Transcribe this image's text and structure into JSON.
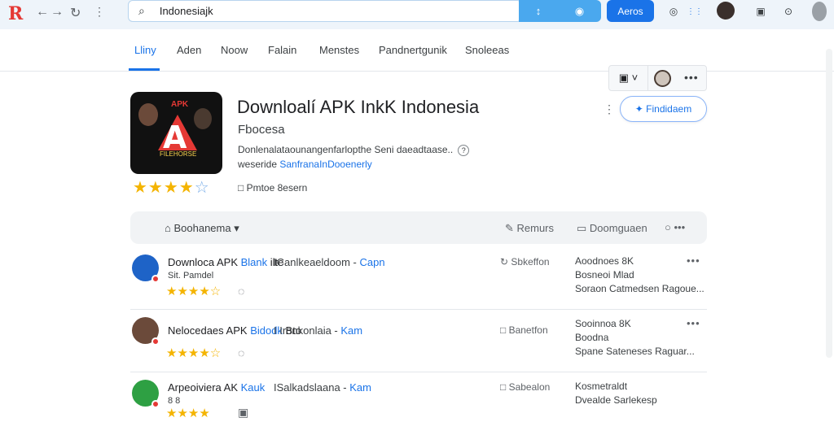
{
  "browser": {
    "logo": "R",
    "back": "←",
    "forward": "→",
    "reload": "↻",
    "more_vert": "⋮",
    "search_glyph": "⌕",
    "url_value": "Indonesiajk",
    "url_icons": [
      "↕",
      "◉"
    ],
    "go_label": "Aeros",
    "right_icons": [
      "◎",
      "⋮⋮",
      "▣",
      "⊙"
    ]
  },
  "tabs": [
    {
      "label": "Lliny",
      "active": true
    },
    {
      "label": "Aden"
    },
    {
      "label": "Noow"
    },
    {
      "label": "Falain"
    },
    {
      "label": "Menstes"
    },
    {
      "label": "Pandnertgunik"
    },
    {
      "label": "Snoleeas"
    }
  ],
  "toolbar": {
    "filter_glyph": "▣ ˅",
    "more": "•••"
  },
  "app": {
    "icon_letter": "A",
    "icon_corner": "APK",
    "icon_tagline": "FILEHORSE",
    "stars": "★★★★",
    "stars_off": "☆",
    "title": "Downloalí APK InkK Indonesia",
    "subtitle": "Fbocesa",
    "description": "Donlenalataounangenfarlopthe Seni daeadtaase..",
    "description_q": "?",
    "website_prefix": "weseride",
    "website_link": "SanfranaInDooenerly",
    "meta_icon": "□",
    "meta": "Pmtoe 8esern",
    "kebab": "⋮",
    "action": "✦ Findidaem"
  },
  "filters": {
    "sort_icon": "⌂",
    "sort_label": "Boohanema ▾",
    "right1": "✎ Remurs",
    "right2": "▭ Doomguaen",
    "right3": "○ •••"
  },
  "rows": [
    {
      "name_a": "Downloca APK ",
      "name_hl": "Blank",
      "name_b": " ilte",
      "sub": "Sit. Pamdel",
      "mid_a": "ICanlkeaeldoom - ",
      "mid_hl": "Capn",
      "stars": "★★★★☆",
      "bubble": "◌",
      "stat": "↻ Sbkeffon",
      "info1": "Aoodnoes 8K",
      "info2": "Bosneoi Mlad",
      "info3": "Soraon Catmedsen Ragoue...",
      "dots": "•••",
      "avatar_color": "#1e63c7"
    },
    {
      "name_a": "Nelocedaes APK ",
      "name_hl": "Bidodk",
      "name_b": " Bto",
      "sub": "",
      "mid_a": "I Ironkonlaia - ",
      "mid_hl": "Kam",
      "stars": "★★★★☆",
      "bubble": "◌",
      "stat": "□ Banetfon",
      "info1": "Sooinnoa 8K",
      "info2": "Boodna",
      "info3": "Spane Sateneses Raguar...",
      "dots": "•••",
      "avatar_color": "#6b4a3a"
    },
    {
      "name_a": "Arpeoiviera AK ",
      "name_hl": "Kauk",
      "name_b": "",
      "sub": "8 8",
      "mid_a": "ISalkadslaana - ",
      "mid_hl": "Kam",
      "stars": "★★★★",
      "bubble": "▣",
      "stat": "□ Sabealon",
      "info1": "Kosmetraldt",
      "info2": "Dvealde Sarlekesp",
      "info3": "",
      "dots": "",
      "avatar_color": "#2ea043"
    }
  ]
}
